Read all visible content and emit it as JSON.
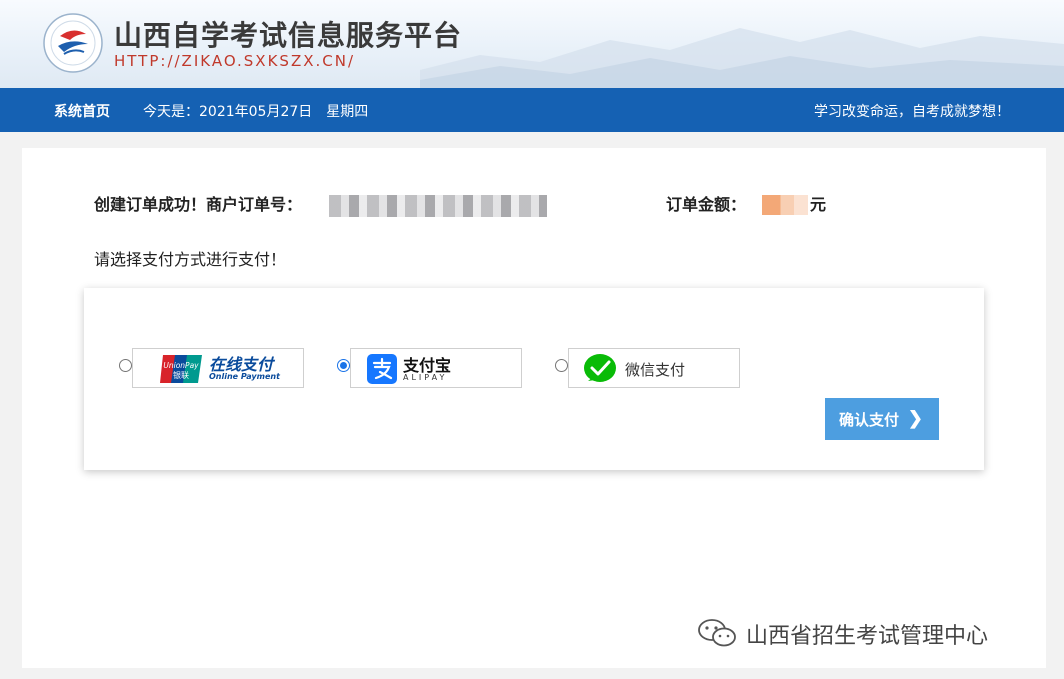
{
  "header": {
    "title": "山西自学考试信息服务平台",
    "url": "HTTP://ZIKAO.SXKSZX.CN/"
  },
  "nav": {
    "home": "系统首页",
    "date": "今天是：2021年05月27日　星期四",
    "slogan": "学习改变命运，自考成就梦想！"
  },
  "order": {
    "success_label": "创建订单成功！商户订单号：",
    "amount_label": "订单金额：",
    "amount_unit": "元",
    "prompt": "请选择支付方式进行支付！"
  },
  "payment": {
    "selected": "alipay",
    "options": [
      {
        "id": "unionpay",
        "logo_text": "UnionPay",
        "logo_sub": "银联",
        "title": "在线支付",
        "subtitle": "Online Payment",
        "color": "#0a4b9c"
      },
      {
        "id": "alipay",
        "title": "支付宝",
        "subtitle": "ALIPAY",
        "color": "#1677ff"
      },
      {
        "id": "wechat",
        "title": "微信支付",
        "color": "#09bb07"
      }
    ],
    "confirm_label": "确认支付",
    "confirm_color": "#4d9ee0"
  },
  "watermark": {
    "text": "山西省招生考试管理中心"
  },
  "colors": {
    "nav": "#1561b3",
    "url": "#c0392b"
  }
}
